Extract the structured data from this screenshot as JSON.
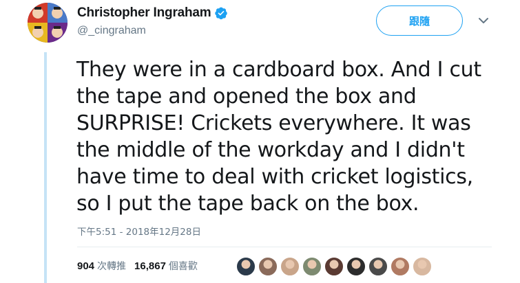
{
  "author": {
    "display_name": "Christopher Ingraham",
    "handle": "@_cingraham",
    "verified": true
  },
  "follow_button": {
    "label": "跟隨"
  },
  "tweet": {
    "lines": [
      "They were in a cardboard box. And I cut",
      "the tape and opened the box and",
      "SURPRISE! Crickets everywhere. It was",
      "the middle of the workday and I didn't",
      "have time to deal with cricket logistics,",
      "so I put the tape back on the box."
    ],
    "timestamp": "下午5:51 - 2018年12月28日"
  },
  "stats": {
    "retweets_count": "904",
    "retweets_label": "次轉推",
    "likes_count": "16,867",
    "likes_label": "個喜歡"
  },
  "colors": {
    "accent": "#1da1f2",
    "thread_line": "#c5e3f6",
    "secondary_text": "#657786"
  },
  "likers": [
    {
      "color": "#2b3a4a"
    },
    {
      "color": "#8a6a5a"
    },
    {
      "color": "#c9a58a"
    },
    {
      "color": "#7d8a70"
    },
    {
      "color": "#5a3a32"
    },
    {
      "color": "#2c2c2c"
    },
    {
      "color": "#4a4a4a"
    },
    {
      "color": "#b07a62"
    },
    {
      "color": "#d8b8a0"
    }
  ]
}
